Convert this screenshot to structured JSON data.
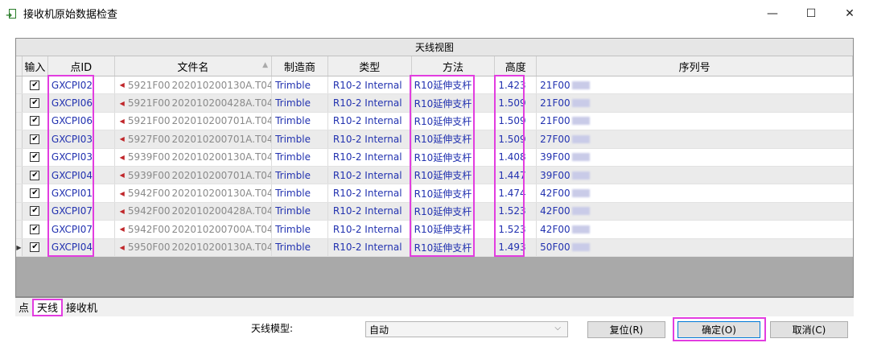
{
  "window": {
    "title": "接收机原始数据检查",
    "minimize_glyph": "—",
    "maximize_glyph": "☐",
    "close_glyph": "✕"
  },
  "grid": {
    "caption": "天线视图",
    "headers": {
      "input": "输入",
      "point_id": "点ID",
      "file_name": "文件名",
      "manufacturer": "制造商",
      "type": "类型",
      "method": "方法",
      "height": "高度",
      "serial": "序列号"
    },
    "rows": [
      {
        "checked": true,
        "point_id": "GXCPI02",
        "file_prefix": "5921F00",
        "file_suffix": "202010200130A.T04",
        "manufacturer": "Trimble",
        "type": "R10-2 Internal",
        "method": "R10延伸支杆",
        "height": "1.423",
        "serial": "21F00"
      },
      {
        "checked": true,
        "point_id": "GXCPI06",
        "file_prefix": "5921F00",
        "file_suffix": "202010200428A.T04",
        "manufacturer": "Trimble",
        "type": "R10-2 Internal",
        "method": "R10延伸支杆",
        "height": "1.509",
        "serial": "21F00"
      },
      {
        "checked": true,
        "point_id": "GXCPI06",
        "file_prefix": "5921F00",
        "file_suffix": "202010200701A.T04",
        "manufacturer": "Trimble",
        "type": "R10-2 Internal",
        "method": "R10延伸支杆",
        "height": "1.509",
        "serial": "21F00"
      },
      {
        "checked": true,
        "point_id": "GXCPI03",
        "file_prefix": "5927F00",
        "file_suffix": "202010200701A.T04",
        "manufacturer": "Trimble",
        "type": "R10-2 Internal",
        "method": "R10延伸支杆",
        "height": "1.509",
        "serial": "27F00"
      },
      {
        "checked": true,
        "point_id": "GXCPI03",
        "file_prefix": "5939F00",
        "file_suffix": "202010200130A.T04",
        "manufacturer": "Trimble",
        "type": "R10-2 Internal",
        "method": "R10延伸支杆",
        "height": "1.408",
        "serial": "39F00"
      },
      {
        "checked": true,
        "point_id": "GXCPI04",
        "file_prefix": "5939F00",
        "file_suffix": "202010200701A.T04",
        "manufacturer": "Trimble",
        "type": "R10-2 Internal",
        "method": "R10延伸支杆",
        "height": "1.447",
        "serial": "39F00"
      },
      {
        "checked": true,
        "point_id": "GXCPI01",
        "file_prefix": "5942F00",
        "file_suffix": "202010200130A.T04",
        "manufacturer": "Trimble",
        "type": "R10-2 Internal",
        "method": "R10延伸支杆",
        "height": "1.474",
        "serial": "42F00"
      },
      {
        "checked": true,
        "point_id": "GXCPI07",
        "file_prefix": "5942F00",
        "file_suffix": "202010200428A.T04",
        "manufacturer": "Trimble",
        "type": "R10-2 Internal",
        "method": "R10延伸支杆",
        "height": "1.523",
        "serial": "42F00"
      },
      {
        "checked": true,
        "point_id": "GXCPI07",
        "file_prefix": "5942F00",
        "file_suffix": "202010200700A.T04",
        "manufacturer": "Trimble",
        "type": "R10-2 Internal",
        "method": "R10延伸支杆",
        "height": "1.523",
        "serial": "42F00"
      },
      {
        "checked": true,
        "current": true,
        "point_id": "GXCPI04",
        "file_prefix": "5950F00",
        "file_suffix": "202010200130A.T04",
        "manufacturer": "Trimble",
        "type": "R10-2 Internal",
        "method": "R10延伸支杆",
        "height": "1.493",
        "serial": "50F00"
      }
    ]
  },
  "tabs": [
    {
      "label": "点",
      "selected": false
    },
    {
      "label": "天线",
      "selected": true
    },
    {
      "label": "接收机",
      "selected": false
    }
  ],
  "footer": {
    "antenna_model_label": "天线模型:",
    "antenna_model_value": "自动",
    "reset_label": "复位(R)",
    "ok_label": "确定(O)",
    "cancel_label": "取消(C)"
  },
  "colors": {
    "highlight": "#e23de0",
    "link_text": "#2232b0",
    "file_marker": "#c0262a",
    "primary_border": "#0078d7"
  }
}
